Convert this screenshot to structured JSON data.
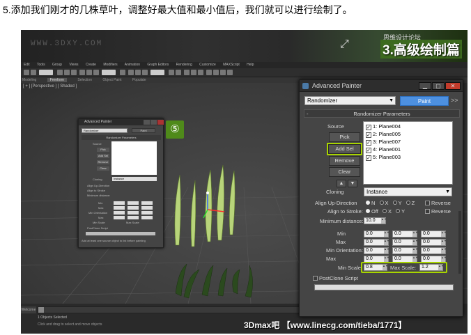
{
  "caption": "5.添加我们刚才的几株草叶，调整好最大值和最小值后，我们就可以进行绘制了。",
  "banner": {
    "watermark": "WWW.3DXY.COM",
    "episode_small": "思维设计论坛",
    "episode": "3.高级绘制篇"
  },
  "menu": [
    "Edit",
    "Tools",
    "Group",
    "Views",
    "Create",
    "Modifiers",
    "Animation",
    "Graph Editors",
    "Rendering",
    "Customize",
    "MAXScript",
    "Help"
  ],
  "ribbon": {
    "tabs": [
      "Modeling",
      "Freeform",
      "Selection",
      "Object Paint",
      "Populate"
    ],
    "active": "Freeform"
  },
  "viewport_label": "[ + ] [Perspective ] [ Shaded ]",
  "status": {
    "tag": "Welcome",
    "timeline": "0 / 100",
    "selected": "1 Objects Selected",
    "hint": "Click and drag to select and move objects",
    "brand": "3Dmax吧 【www.linecg.com/tieba/1771】"
  },
  "small_dialog": {
    "title": "Advanced Painter",
    "preset": "Randomizer",
    "paint": "Paint",
    "rollout": "Randomizer Parameters",
    "source": "Source",
    "pick": "Pick",
    "add_sel": "Add Sel",
    "remove": "Remove",
    "clear": "Clear",
    "cloning": "Cloning",
    "cloning_value": "Instance",
    "align_up": "Align Up-Direction",
    "align_stroke": "Align to Stroke",
    "min_distance": "Minimum distance:",
    "min": "Min",
    "max": "Max",
    "min_orientation": "Min Orientation",
    "max_o": "Max",
    "min_scale": "Min Scale",
    "max_scale": "Max Scale",
    "postclone": "PostClone Script",
    "hint": "Add at least one source object to list before painting"
  },
  "step_badge": "⑤",
  "dialog": {
    "title": "Advanced Painter",
    "preset": "Randomizer",
    "paint_label": "Paint",
    "chevron": ">>",
    "rollout_label": "Randomizer Parameters",
    "rollout_sign": "-",
    "source_label": "Source",
    "pick_label": "Pick",
    "add_sel_label": "Add Sel",
    "remove_label": "Remove",
    "clear_label": "Clear",
    "sources": [
      {
        "checked": true,
        "name": "1: Plane004"
      },
      {
        "checked": true,
        "name": "2: Plane005"
      },
      {
        "checked": true,
        "name": "3: Plane007"
      },
      {
        "checked": true,
        "name": "4: Plane001"
      },
      {
        "checked": true,
        "name": "5: Plane003"
      }
    ],
    "cloning_label": "Cloning",
    "cloning_value": "Instance",
    "align_up_label": "Align Up-Direction",
    "align_up_options": [
      "N",
      "X",
      "Y",
      "Z"
    ],
    "align_up_selected": "N",
    "align_stroke_label": "Align to Stroke:",
    "align_stroke_options": [
      "Off",
      "X",
      "Y"
    ],
    "align_stroke_selected": "Off",
    "reverse_label": "Reverse",
    "min_distance_label": "Minimum distance:",
    "min_distance_value": "10.0",
    "min_label": "Min",
    "max_label": "Max",
    "min_orientation_label": "Min Orientation:",
    "max2_label": "Max",
    "min_values": [
      "0.0",
      "0.0",
      "0.0"
    ],
    "max_values": [
      "0.0",
      "0.0",
      "0.0"
    ],
    "min_orient_values": [
      "0.0",
      "0.0",
      "0.0"
    ],
    "max_orient_values": [
      "0.0",
      "0.0",
      "0.0"
    ],
    "min_scale_label": "Min Scale:",
    "min_scale_value": "0.8",
    "max_scale_label": "Max Scale:",
    "max_scale_value": "1.2",
    "postclone_label": "PostClone Script"
  }
}
